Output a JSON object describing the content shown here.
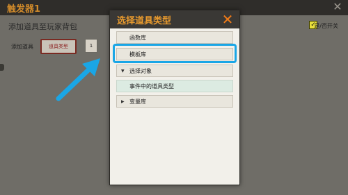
{
  "window": {
    "title": "触发器1"
  },
  "editor": {
    "section_title": "添加道具至玩家背包",
    "add_item_label": "添加道具",
    "item_type_button": "道具类型",
    "count_value": "1",
    "toggle_label": "是/否开关"
  },
  "dialog": {
    "title": "选择道具类型",
    "items": [
      {
        "label": "函数库",
        "expandable": false
      },
      {
        "label": "模板库",
        "expandable": false,
        "highlighted": true
      },
      {
        "label": "选择对象",
        "expandable": true,
        "expanded": true
      },
      {
        "label": "事件中的道具类型",
        "expandable": false,
        "sub_item": true
      },
      {
        "label": "变量库",
        "expandable": true,
        "expanded": false
      }
    ]
  },
  "colors": {
    "highlight": "#1aa6e6",
    "title_orange": "#e89a2e",
    "close_orange": "#f07b18"
  },
  "icons": {
    "close": "close-x-icon",
    "expanded": "triangle-down-icon",
    "collapsed": "triangle-right-icon",
    "pointer": "arrow-pointer-icon"
  }
}
